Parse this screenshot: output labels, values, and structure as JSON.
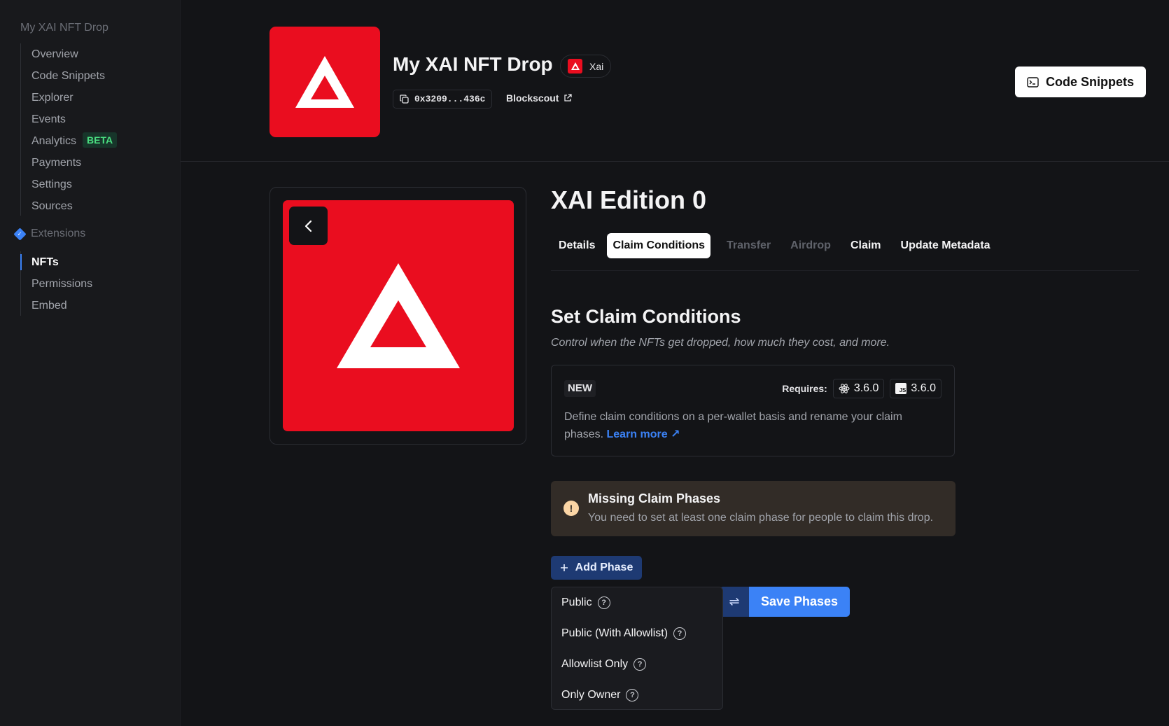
{
  "sidebar": {
    "title": "My XAI NFT Drop",
    "items": [
      {
        "label": "Overview"
      },
      {
        "label": "Code Snippets"
      },
      {
        "label": "Explorer"
      },
      {
        "label": "Events"
      },
      {
        "label": "Analytics",
        "badge": "BETA"
      },
      {
        "label": "Payments"
      },
      {
        "label": "Settings"
      },
      {
        "label": "Sources"
      }
    ],
    "extensions_label": "Extensions",
    "extension_items": [
      {
        "label": "NFTs",
        "active": true
      },
      {
        "label": "Permissions"
      },
      {
        "label": "Embed"
      }
    ]
  },
  "header": {
    "title": "My XAI NFT Drop",
    "chain": "Xai",
    "address": "0x3209...436c",
    "explorer": "Blockscout",
    "code_snippets_label": "Code Snippets"
  },
  "nft": {
    "name": "XAI Edition 0"
  },
  "tabs": [
    {
      "label": "Details",
      "state": "normal"
    },
    {
      "label": "Claim Conditions",
      "state": "active"
    },
    {
      "label": "Transfer",
      "state": "disabled"
    },
    {
      "label": "Airdrop",
      "state": "disabled"
    },
    {
      "label": "Claim",
      "state": "normal"
    },
    {
      "label": "Update Metadata",
      "state": "normal"
    }
  ],
  "claim": {
    "title": "Set Claim Conditions",
    "subtitle": "Control when the NFTs get dropped, how much they cost, and more.",
    "new_box": {
      "tag": "NEW",
      "requires_label": "Requires:",
      "react_version": "3.6.0",
      "js_version": "3.6.0",
      "description": "Define claim conditions on a per-wallet basis and rename your claim phases.",
      "learn_more": "Learn more ↗"
    },
    "alert": {
      "title": "Missing Claim Phases",
      "text": "You need to set at least one claim phase for people to claim this drop."
    },
    "add_phase_label": "Add Phase",
    "save_label": "Save Phases",
    "phase_options": [
      {
        "label": "Public"
      },
      {
        "label": "Public (With Allowlist)"
      },
      {
        "label": "Allowlist Only"
      },
      {
        "label": "Only Owner"
      }
    ]
  },
  "colors": {
    "brand_red": "#ea0d1f",
    "accent_blue": "#3b82f6",
    "background": "#131417"
  }
}
